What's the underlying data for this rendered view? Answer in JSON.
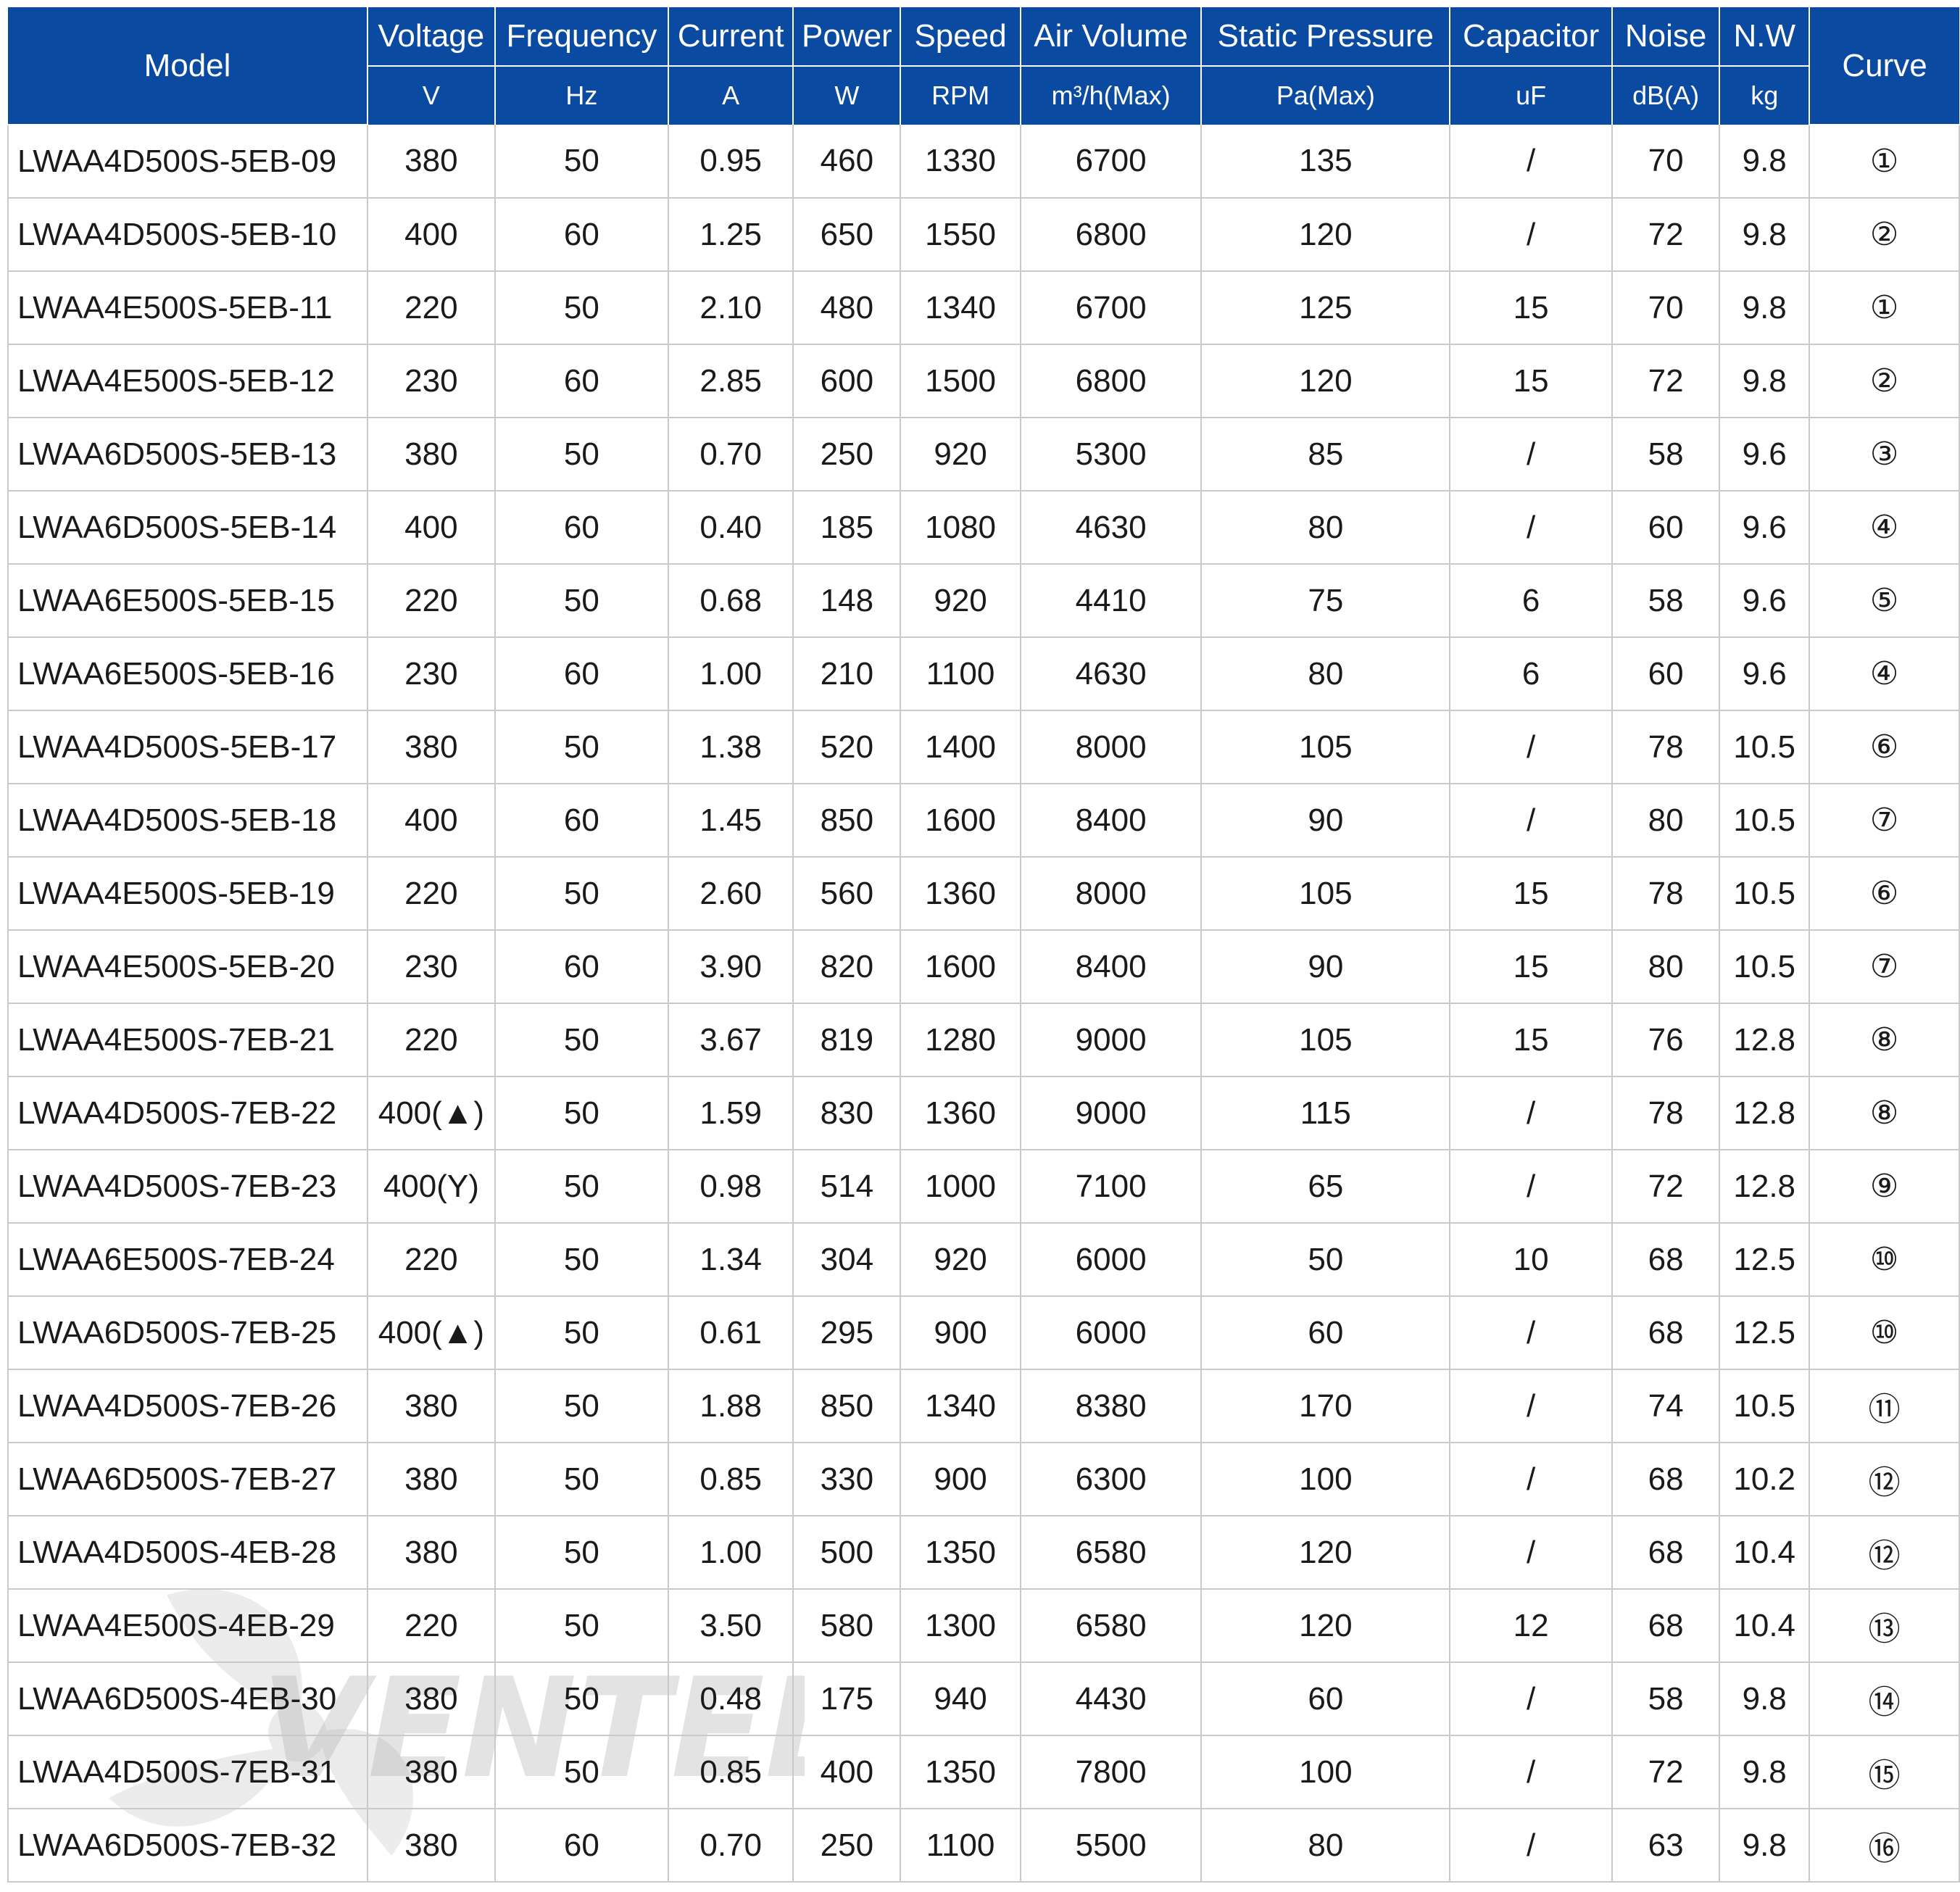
{
  "table": {
    "headers": [
      {
        "label": "Model",
        "unit": ""
      },
      {
        "label": "Voltage",
        "unit": "V"
      },
      {
        "label": "Frequency",
        "unit": "Hz"
      },
      {
        "label": "Current",
        "unit": "A"
      },
      {
        "label": "Power",
        "unit": "W"
      },
      {
        "label": "Speed",
        "unit": "RPM"
      },
      {
        "label": "Air Volume",
        "unit": "m³/h(Max)"
      },
      {
        "label": "Static Pressure",
        "unit": "Pa(Max)"
      },
      {
        "label": "Capacitor",
        "unit": "uF"
      },
      {
        "label": "Noise",
        "unit": "dB(A)"
      },
      {
        "label": "N.W",
        "unit": "kg"
      },
      {
        "label": "Curve",
        "unit": ""
      }
    ],
    "rows": [
      [
        "LWAA4D500S-5EB-09",
        "380",
        "50",
        "0.95",
        "460",
        "1330",
        "6700",
        "135",
        "/",
        "70",
        "9.8",
        "①"
      ],
      [
        "LWAA4D500S-5EB-10",
        "400",
        "60",
        "1.25",
        "650",
        "1550",
        "6800",
        "120",
        "/",
        "72",
        "9.8",
        "②"
      ],
      [
        "LWAA4E500S-5EB-11",
        "220",
        "50",
        "2.10",
        "480",
        "1340",
        "6700",
        "125",
        "15",
        "70",
        "9.8",
        "①"
      ],
      [
        "LWAA4E500S-5EB-12",
        "230",
        "60",
        "2.85",
        "600",
        "1500",
        "6800",
        "120",
        "15",
        "72",
        "9.8",
        "②"
      ],
      [
        "LWAA6D500S-5EB-13",
        "380",
        "50",
        "0.70",
        "250",
        "920",
        "5300",
        "85",
        "/",
        "58",
        "9.6",
        "③"
      ],
      [
        "LWAA6D500S-5EB-14",
        "400",
        "60",
        "0.40",
        "185",
        "1080",
        "4630",
        "80",
        "/",
        "60",
        "9.6",
        "④"
      ],
      [
        "LWAA6E500S-5EB-15",
        "220",
        "50",
        "0.68",
        "148",
        "920",
        "4410",
        "75",
        "6",
        "58",
        "9.6",
        "⑤"
      ],
      [
        "LWAA6E500S-5EB-16",
        "230",
        "60",
        "1.00",
        "210",
        "1100",
        "4630",
        "80",
        "6",
        "60",
        "9.6",
        "④"
      ],
      [
        "LWAA4D500S-5EB-17",
        "380",
        "50",
        "1.38",
        "520",
        "1400",
        "8000",
        "105",
        "/",
        "78",
        "10.5",
        "⑥"
      ],
      [
        "LWAA4D500S-5EB-18",
        "400",
        "60",
        "1.45",
        "850",
        "1600",
        "8400",
        "90",
        "/",
        "80",
        "10.5",
        "⑦"
      ],
      [
        "LWAA4E500S-5EB-19",
        "220",
        "50",
        "2.60",
        "560",
        "1360",
        "8000",
        "105",
        "15",
        "78",
        "10.5",
        "⑥"
      ],
      [
        "LWAA4E500S-5EB-20",
        "230",
        "60",
        "3.90",
        "820",
        "1600",
        "8400",
        "90",
        "15",
        "80",
        "10.5",
        "⑦"
      ],
      [
        "LWAA4E500S-7EB-21",
        "220",
        "50",
        "3.67",
        "819",
        "1280",
        "9000",
        "105",
        "15",
        "76",
        "12.8",
        "⑧"
      ],
      [
        "LWAA4D500S-7EB-22",
        "400(▲)",
        "50",
        "1.59",
        "830",
        "1360",
        "9000",
        "115",
        "/",
        "78",
        "12.8",
        "⑧"
      ],
      [
        "LWAA4D500S-7EB-23",
        "400(Y)",
        "50",
        "0.98",
        "514",
        "1000",
        "7100",
        "65",
        "/",
        "72",
        "12.8",
        "⑨"
      ],
      [
        "LWAA6E500S-7EB-24",
        "220",
        "50",
        "1.34",
        "304",
        "920",
        "6000",
        "50",
        "10",
        "68",
        "12.5",
        "⑩"
      ],
      [
        "LWAA6D500S-7EB-25",
        "400(▲)",
        "50",
        "0.61",
        "295",
        "900",
        "6000",
        "60",
        "/",
        "68",
        "12.5",
        "⑩"
      ],
      [
        "LWAA4D500S-7EB-26",
        "380",
        "50",
        "1.88",
        "850",
        "1340",
        "8380",
        "170",
        "/",
        "74",
        "10.5",
        "⑪"
      ],
      [
        "LWAA6D500S-7EB-27",
        "380",
        "50",
        "0.85",
        "330",
        "900",
        "6300",
        "100",
        "/",
        "68",
        "10.2",
        "⑫"
      ],
      [
        "LWAA4D500S-4EB-28",
        "380",
        "50",
        "1.00",
        "500",
        "1350",
        "6580",
        "120",
        "/",
        "68",
        "10.4",
        "⑫"
      ],
      [
        "LWAA4E500S-4EB-29",
        "220",
        "50",
        "3.50",
        "580",
        "1300",
        "6580",
        "120",
        "12",
        "68",
        "10.4",
        "⑬"
      ],
      [
        "LWAA6D500S-4EB-30",
        "380",
        "50",
        "0.48",
        "175",
        "940",
        "4430",
        "60",
        "/",
        "58",
        "9.8",
        "⑭"
      ],
      [
        "LWAA4D500S-7EB-31",
        "380",
        "50",
        "0.85",
        "400",
        "1350",
        "7800",
        "100",
        "/",
        "72",
        "9.8",
        "⑮"
      ],
      [
        "LWAA6D500S-7EB-32",
        "380",
        "60",
        "0.70",
        "250",
        "1100",
        "5500",
        "80",
        "/",
        "63",
        "9.8",
        "⑯"
      ]
    ]
  },
  "watermark": {
    "text": "VENTEL",
    "icon": "fan-icon"
  },
  "colors": {
    "header_bg": "#0a4aa0",
    "header_text": "#ffffff",
    "grid": "#c9c9c9",
    "body_text": "#1a1a1a"
  }
}
